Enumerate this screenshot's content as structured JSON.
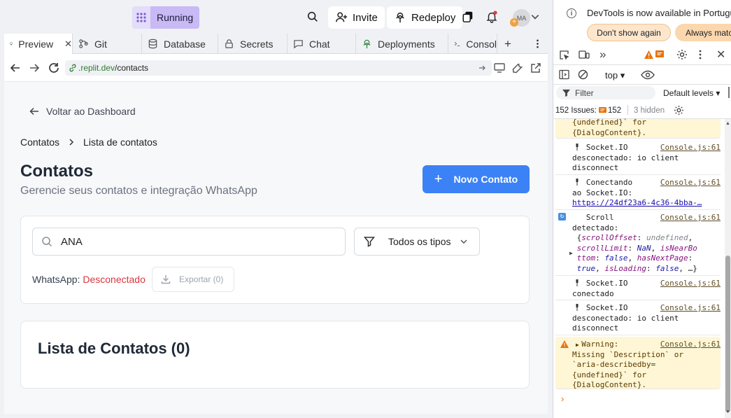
{
  "topbar": {
    "run_label": "Running",
    "invite_label": "Invite",
    "redeploy_label": "Redeploy",
    "avatar_initials": "MA",
    "accent_color": "#c9b9f5"
  },
  "tabs": [
    {
      "label": "Preview",
      "icon": "monitor-icon"
    },
    {
      "label": "Git",
      "icon": "git-icon"
    },
    {
      "label": "Database",
      "icon": "database-icon"
    },
    {
      "label": "Secrets",
      "icon": "lock-icon"
    },
    {
      "label": "Chat",
      "icon": "chat-icon"
    },
    {
      "label": "Deployments",
      "icon": "deploy-icon"
    },
    {
      "label": "Consol",
      "icon": "terminal-icon"
    }
  ],
  "url": {
    "host": ".replit.dev",
    "path": "/contacts"
  },
  "app": {
    "back_label": "Voltar ao Dashboard",
    "breadcrumb": [
      "Contatos",
      "Lista de contatos"
    ],
    "title": "Contatos",
    "subtitle": "Gerencie seus contatos e integração WhatsApp",
    "new_button": "Novo Contato",
    "search_value": "ANA",
    "filter_value": "Todos os tipos",
    "whatsapp_label": "WhatsApp:",
    "whatsapp_status": "Desconectado",
    "export_label": "Exportar (0)",
    "list_title": "Lista de Contatos (0)",
    "primary_color": "#3b82f6",
    "error_color": "#d9363e"
  },
  "devtools": {
    "notice": "DevTools is now available in Portugu",
    "dont_show": "Don't show again",
    "always_match": "Always matc",
    "context": "top",
    "filter_placeholder": "Filter",
    "levels": "Default levels",
    "issues_label": "152 Issues:",
    "issues_count": "152",
    "hidden": "3 hidden",
    "top_warn_1": "{undefined}` for",
    "top_warn_2": "{DialogContent}.",
    "source": "Console.js:61",
    "logs": {
      "l1a": "Socket.IO",
      "l1b": "desconectado: io client",
      "l1c": "disconnect",
      "l2a": "Conectando",
      "l2b": "ao Socket.IO:",
      "l2c": "https://24df23a6-4c36-4bba-…",
      "l3a": "Scroll",
      "l3b": "detectado:",
      "l4a": "Socket.IO",
      "l4b": "conectado",
      "l5a": "Socket.IO",
      "l5b": "desconectado: io client",
      "l5c": "disconnect",
      "w1": "Warning:",
      "w2": "Missing `Description` or",
      "w3": "`aria-describedby=",
      "w4": "{undefined}` for",
      "w5": "{DialogContent}."
    },
    "scroll_obj": {
      "p1": "scrollOffset",
      "v1": "undefined",
      "p2": "scrollLimit",
      "v2": "NaN",
      "p3": "isNearBo",
      "p3b": "ttom",
      "v3": "false",
      "p4": "hasNextPage",
      "v4": "true",
      "p5": "isLoading",
      "v5": "false"
    }
  }
}
